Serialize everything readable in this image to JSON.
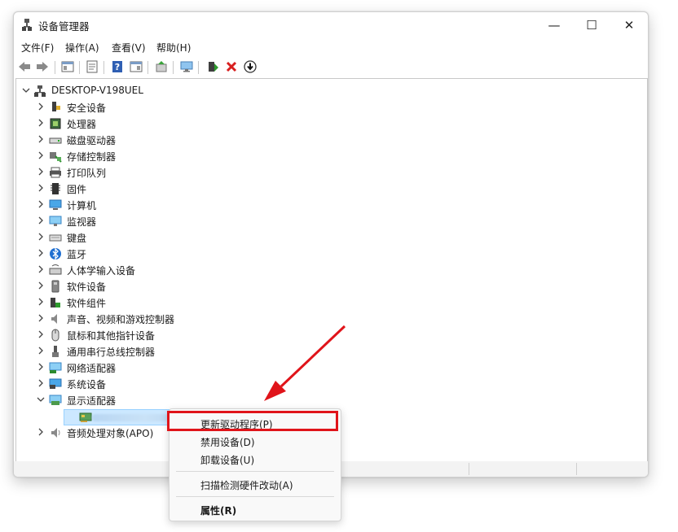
{
  "window": {
    "title": "设备管理器",
    "caption": {
      "minimize": "—",
      "maximize": "☐",
      "close": "✕"
    }
  },
  "menubar": {
    "items": [
      {
        "label": "文件(F)"
      },
      {
        "label": "操作(A)"
      },
      {
        "label": "查看(V)"
      },
      {
        "label": "帮助(H)"
      }
    ]
  },
  "toolbar": {
    "icons": [
      "back-arrow-icon",
      "forward-arrow-icon",
      "show-hide-tree-icon",
      "properties-icon",
      "help-icon",
      "action-pane-icon",
      "update-driver-icon",
      "monitor-scan-icon",
      "enable-device-icon",
      "uninstall-x-icon",
      "download-icon"
    ]
  },
  "tree": {
    "root": "DESKTOP-V198UEL",
    "categories": [
      {
        "label": "安全设备",
        "icon": "security-device-icon"
      },
      {
        "label": "处理器",
        "icon": "processor-icon"
      },
      {
        "label": "磁盘驱动器",
        "icon": "disk-drive-icon"
      },
      {
        "label": "存储控制器",
        "icon": "storage-controller-icon"
      },
      {
        "label": "打印队列",
        "icon": "printer-icon"
      },
      {
        "label": "固件",
        "icon": "firmware-icon"
      },
      {
        "label": "计算机",
        "icon": "computer-icon"
      },
      {
        "label": "监视器",
        "icon": "monitor-icon"
      },
      {
        "label": "键盘",
        "icon": "keyboard-icon"
      },
      {
        "label": "蓝牙",
        "icon": "bluetooth-icon"
      },
      {
        "label": "人体学输入设备",
        "icon": "hid-icon"
      },
      {
        "label": "软件设备",
        "icon": "software-device-icon"
      },
      {
        "label": "软件组件",
        "icon": "software-component-icon"
      },
      {
        "label": "声音、视频和游戏控制器",
        "icon": "sound-icon"
      },
      {
        "label": "鼠标和其他指针设备",
        "icon": "mouse-icon"
      },
      {
        "label": "通用串行总线控制器",
        "icon": "usb-icon"
      },
      {
        "label": "网络适配器",
        "icon": "network-adapter-icon"
      },
      {
        "label": "系统设备",
        "icon": "system-device-icon"
      },
      {
        "label": "显示适配器",
        "icon": "display-adapter-icon"
      }
    ],
    "after_selected": {
      "label": "音频处理对象(APO)",
      "icon": "audio-apo-icon"
    }
  },
  "context_menu": {
    "items": [
      {
        "label": "更新驱动程序(P)",
        "bold": false
      },
      {
        "label": "禁用设备(D)",
        "bold": false
      },
      {
        "label": "卸载设备(U)",
        "bold": false
      },
      {
        "label": "扫描检测硬件改动(A)",
        "bold": false
      },
      {
        "label": "属性(R)",
        "bold": true
      }
    ]
  },
  "colors": {
    "annotation_red": "#e0141a",
    "selection_bg": "#cce8ff"
  }
}
